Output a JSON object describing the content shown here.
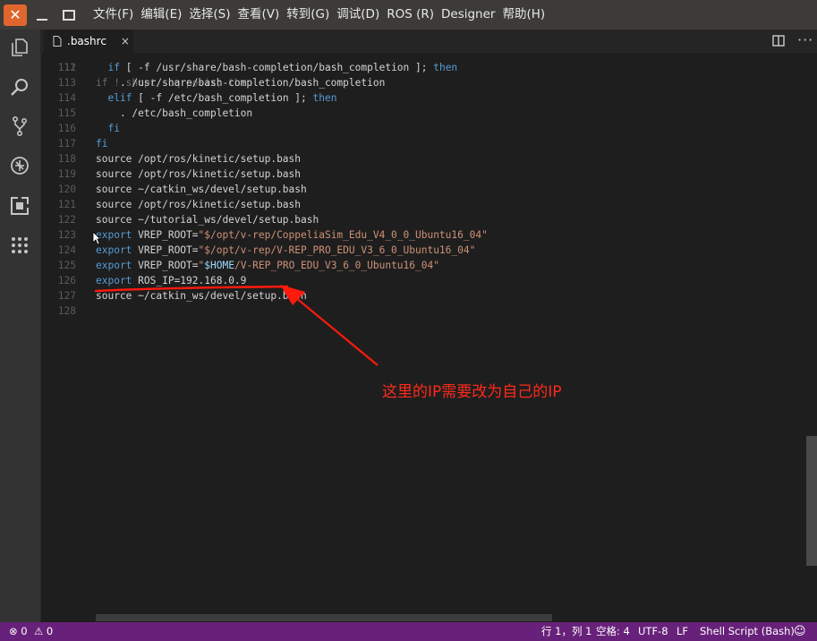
{
  "menu": [
    "文件(F)",
    "编辑(E)",
    "选择(S)",
    "查看(V)",
    "转到(G)",
    "调试(D)",
    "ROS (R)",
    "Designer",
    "帮助(H)"
  ],
  "window_controls": {
    "close": "✕"
  },
  "tab": {
    "filename": ".bashrc",
    "close": "×"
  },
  "editor_more": "···",
  "top_partial_line": {
    "ln": "111",
    "text": "if ! shopt -oq posix; then"
  },
  "lines": [
    {
      "ln": "112",
      "text": "  if [ -f /usr/share/bash-completion/bash_completion ]; then"
    },
    {
      "ln": "113",
      "text": "    . /usr/share/bash-completion/bash_completion"
    },
    {
      "ln": "114",
      "text": "  elif [ -f /etc/bash_completion ]; then"
    },
    {
      "ln": "115",
      "text": "    . /etc/bash_completion"
    },
    {
      "ln": "116",
      "text": "  fi"
    },
    {
      "ln": "117",
      "text": "fi"
    },
    {
      "ln": "118",
      "text": "source /opt/ros/kinetic/setup.bash"
    },
    {
      "ln": "119",
      "text": "source /opt/ros/kinetic/setup.bash"
    },
    {
      "ln": "120",
      "text": "source ~/catkin_ws/devel/setup.bash"
    },
    {
      "ln": "121",
      "text": "source /opt/ros/kinetic/setup.bash"
    },
    {
      "ln": "122",
      "text": "source ~/tutorial_ws/devel/setup.bash"
    },
    {
      "ln": "123",
      "text": "export VREP_ROOT=\"$/opt/v-rep/CoppeliaSim_Edu_V4_0_0_Ubuntu16_04\""
    },
    {
      "ln": "124",
      "text": "export VREP_ROOT=\"$/opt/v-rep/V-REP_PRO_EDU_V3_6_0_Ubuntu16_04\""
    },
    {
      "ln": "125",
      "text": "export VREP_ROOT=\"$HOME/V-REP_PRO_EDU_V3_6_0_Ubuntu16_04\""
    },
    {
      "ln": "126",
      "text": "export ROS_IP=192.168.0.9"
    },
    {
      "ln": "127",
      "text": "source ~/catkin_ws/devel/setup.bash"
    },
    {
      "ln": "128",
      "text": ""
    }
  ],
  "annotation": {
    "text": "这里的IP需要改为自己的IP",
    "color": "#ff2a1a"
  },
  "statusbar": {
    "errors": "0",
    "warnings": "0",
    "position": "行 1，列 1",
    "spaces": "空格: 4",
    "encoding": "UTF-8",
    "eol": "LF",
    "language": "Shell Script (Bash)",
    "feedback_icon": "smiley-icon"
  },
  "colors": {
    "statusbar": "#68217a",
    "keyword": "#569cd6",
    "string": "#ce9178",
    "close_button": "#e0662e"
  }
}
